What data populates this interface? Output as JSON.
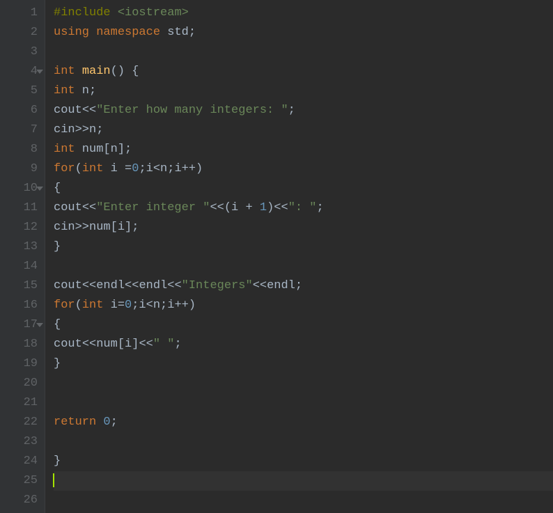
{
  "lines": [
    {
      "num": "1",
      "fold": false,
      "tokens": [
        {
          "t": "#include",
          "c": "preprocessor"
        },
        {
          "t": " ",
          "c": ""
        },
        {
          "t": "<iostream>",
          "c": "include-bracket"
        }
      ]
    },
    {
      "num": "2",
      "fold": false,
      "tokens": [
        {
          "t": "using",
          "c": "keyword"
        },
        {
          "t": " ",
          "c": ""
        },
        {
          "t": "namespace",
          "c": "keyword"
        },
        {
          "t": " ",
          "c": ""
        },
        {
          "t": "std",
          "c": "identifier"
        },
        {
          "t": ";",
          "c": "punct"
        }
      ]
    },
    {
      "num": "3",
      "fold": false,
      "tokens": []
    },
    {
      "num": "4",
      "fold": true,
      "tokens": [
        {
          "t": "int",
          "c": "type"
        },
        {
          "t": " ",
          "c": ""
        },
        {
          "t": "main",
          "c": "func"
        },
        {
          "t": "() {",
          "c": "punct"
        }
      ]
    },
    {
      "num": "5",
      "fold": false,
      "tokens": [
        {
          "t": "int",
          "c": "type"
        },
        {
          "t": " n;",
          "c": "identifier"
        }
      ]
    },
    {
      "num": "6",
      "fold": false,
      "tokens": [
        {
          "t": "cout",
          "c": "identifier"
        },
        {
          "t": "<<",
          "c": "operator"
        },
        {
          "t": "\"Enter how many integers: \"",
          "c": "string"
        },
        {
          "t": ";",
          "c": "punct"
        }
      ]
    },
    {
      "num": "7",
      "fold": false,
      "tokens": [
        {
          "t": "cin",
          "c": "identifier"
        },
        {
          "t": ">>",
          "c": "operator"
        },
        {
          "t": "n;",
          "c": "identifier"
        }
      ]
    },
    {
      "num": "8",
      "fold": false,
      "tokens": [
        {
          "t": "int",
          "c": "type"
        },
        {
          "t": " num[n];",
          "c": "identifier"
        }
      ]
    },
    {
      "num": "9",
      "fold": false,
      "tokens": [
        {
          "t": "for",
          "c": "keyword"
        },
        {
          "t": "(",
          "c": "punct"
        },
        {
          "t": "int",
          "c": "type"
        },
        {
          "t": " i =",
          "c": "identifier"
        },
        {
          "t": "0",
          "c": "number"
        },
        {
          "t": ";i<n;i++)",
          "c": "identifier"
        }
      ]
    },
    {
      "num": "10",
      "fold": true,
      "tokens": [
        {
          "t": "{",
          "c": "punct"
        }
      ]
    },
    {
      "num": "11",
      "fold": false,
      "tokens": [
        {
          "t": "cout",
          "c": "identifier"
        },
        {
          "t": "<<",
          "c": "operator"
        },
        {
          "t": "\"Enter integer \"",
          "c": "string"
        },
        {
          "t": "<<(i + ",
          "c": "identifier"
        },
        {
          "t": "1",
          "c": "number"
        },
        {
          "t": ")<<",
          "c": "identifier"
        },
        {
          "t": "\": \"",
          "c": "string"
        },
        {
          "t": ";",
          "c": "punct"
        }
      ]
    },
    {
      "num": "12",
      "fold": false,
      "tokens": [
        {
          "t": "cin",
          "c": "identifier"
        },
        {
          "t": ">>",
          "c": "operator"
        },
        {
          "t": "num[i];",
          "c": "identifier"
        }
      ]
    },
    {
      "num": "13",
      "fold": false,
      "tokens": [
        {
          "t": "}",
          "c": "punct"
        }
      ]
    },
    {
      "num": "14",
      "fold": false,
      "tokens": []
    },
    {
      "num": "15",
      "fold": false,
      "tokens": [
        {
          "t": "cout",
          "c": "identifier"
        },
        {
          "t": "<<",
          "c": "operator"
        },
        {
          "t": "endl",
          "c": "identifier"
        },
        {
          "t": "<<",
          "c": "operator"
        },
        {
          "t": "endl",
          "c": "identifier"
        },
        {
          "t": "<<",
          "c": "operator"
        },
        {
          "t": "\"Integers\"",
          "c": "string"
        },
        {
          "t": "<<",
          "c": "operator"
        },
        {
          "t": "endl",
          "c": "identifier"
        },
        {
          "t": ";",
          "c": "punct"
        }
      ]
    },
    {
      "num": "16",
      "fold": false,
      "tokens": [
        {
          "t": "for",
          "c": "keyword"
        },
        {
          "t": "(",
          "c": "punct"
        },
        {
          "t": "int",
          "c": "type"
        },
        {
          "t": " i=",
          "c": "identifier"
        },
        {
          "t": "0",
          "c": "number"
        },
        {
          "t": ";i<n;i++)",
          "c": "identifier"
        }
      ]
    },
    {
      "num": "17",
      "fold": true,
      "tokens": [
        {
          "t": "{",
          "c": "punct"
        }
      ]
    },
    {
      "num": "18",
      "fold": false,
      "tokens": [
        {
          "t": "cout",
          "c": "identifier"
        },
        {
          "t": "<<",
          "c": "operator"
        },
        {
          "t": "num[i]",
          "c": "identifier"
        },
        {
          "t": "<<",
          "c": "operator"
        },
        {
          "t": "\" \"",
          "c": "string"
        },
        {
          "t": ";",
          "c": "punct"
        }
      ]
    },
    {
      "num": "19",
      "fold": false,
      "tokens": [
        {
          "t": "}",
          "c": "punct"
        }
      ]
    },
    {
      "num": "20",
      "fold": false,
      "tokens": []
    },
    {
      "num": "21",
      "fold": false,
      "tokens": []
    },
    {
      "num": "22",
      "fold": false,
      "tokens": [
        {
          "t": "return",
          "c": "keyword"
        },
        {
          "t": " ",
          "c": ""
        },
        {
          "t": "0",
          "c": "number"
        },
        {
          "t": ";",
          "c": "punct"
        }
      ]
    },
    {
      "num": "23",
      "fold": false,
      "tokens": []
    },
    {
      "num": "24",
      "fold": false,
      "tokens": [
        {
          "t": "}",
          "c": "punct"
        }
      ]
    },
    {
      "num": "25",
      "fold": false,
      "tokens": [],
      "cursor": true
    },
    {
      "num": "26",
      "fold": false,
      "tokens": []
    }
  ]
}
